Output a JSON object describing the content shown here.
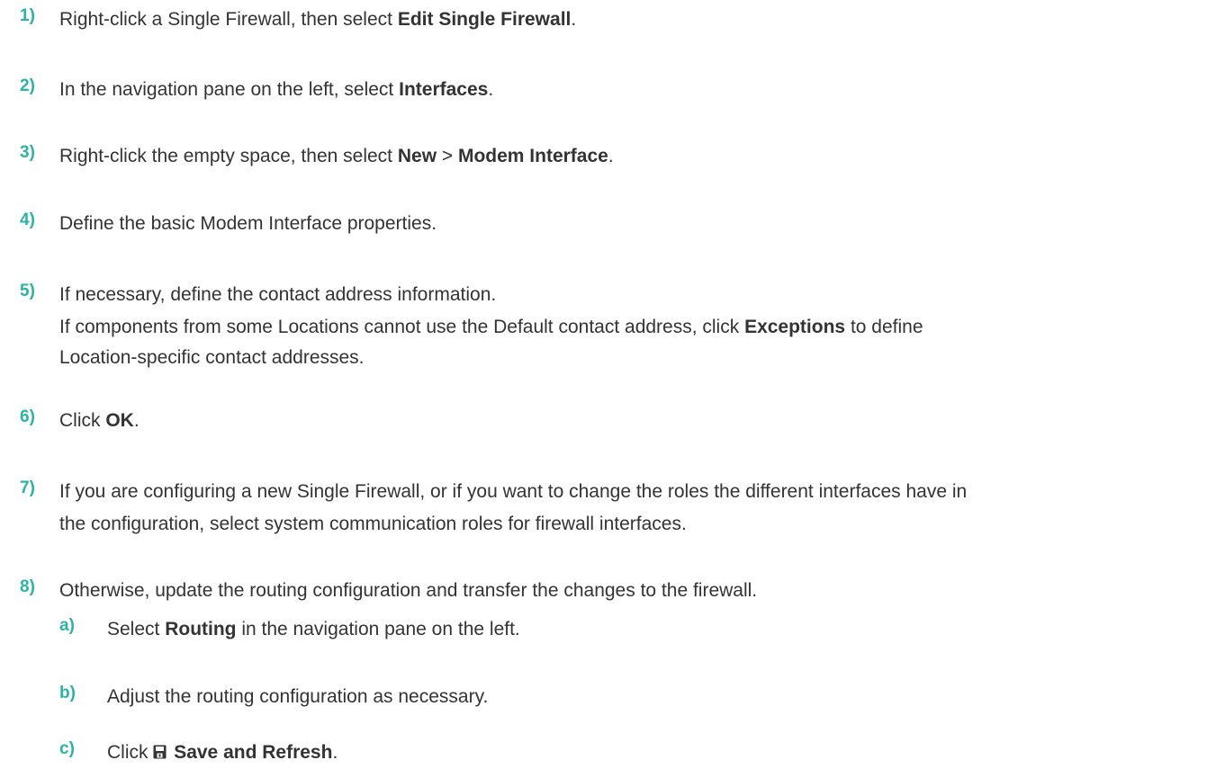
{
  "accent_color": "#2bb3a3",
  "text_color": "#333333",
  "steps": [
    {
      "number": "1)",
      "pre": "Right-click a Single Firewall, then select ",
      "bold": "Edit Single Firewall",
      "post": "."
    },
    {
      "number": "2)",
      "pre": "In the navigation pane on the left, select ",
      "bold": "Interfaces",
      "post": "."
    },
    {
      "number": "3)",
      "pre": "Right-click the empty space, then select ",
      "bold1": "New",
      "mid": " > ",
      "bold2": "Modem Interface",
      "post": "."
    },
    {
      "number": "4)",
      "text": "Define the basic Modem Interface properties."
    },
    {
      "number": "5)",
      "text": "If necessary, define the contact address information.",
      "note_pre": "If components from some Locations cannot use the Default contact address, click ",
      "note_bold": "Exceptions",
      "note_post1": " to define",
      "note_post2": "Location-specific contact addresses."
    },
    {
      "number": "6)",
      "pre": "Click ",
      "bold": "OK",
      "post": "."
    },
    {
      "number": "7)",
      "line1": "If you are configuring a new Single Firewall, or if you want to change the roles the different interfaces have in",
      "line2": "the configuration, select system communication roles for firewall interfaces."
    },
    {
      "number": "8)",
      "text": "Otherwise, update the routing configuration and transfer the changes to the firewall.",
      "substeps": [
        {
          "letter": "a)",
          "pre": "Select ",
          "bold": "Routing",
          "post": " in the navigation pane on the left."
        },
        {
          "letter": "b)",
          "text": "Adjust the routing configuration as necessary."
        },
        {
          "letter": "c)",
          "pre": "Click ",
          "icon": "save-icon",
          "bold": "Save and Refresh",
          "post": "."
        }
      ]
    }
  ]
}
